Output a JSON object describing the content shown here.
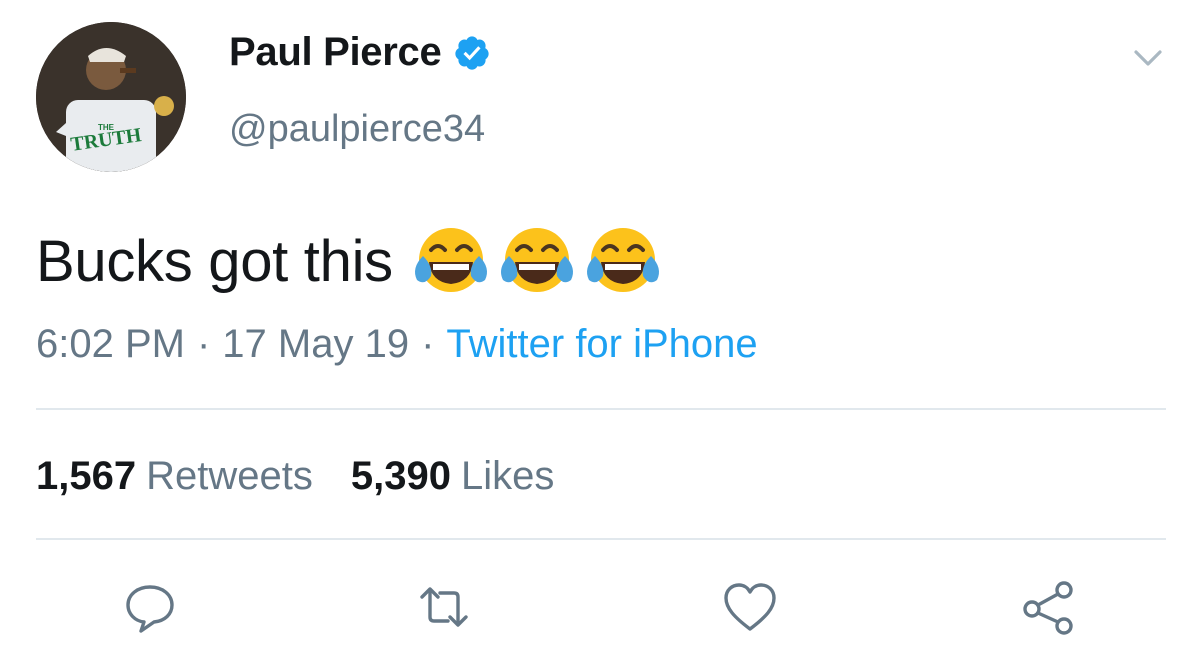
{
  "user": {
    "display_name": "Paul Pierce",
    "handle": "@paulpierce34",
    "verified": true,
    "avatar_shirt_text": "TRUTH",
    "avatar_shirt_small_text": "THE"
  },
  "tweet": {
    "text": "Bucks got this",
    "emoji_name": "face-with-tears-of-joy",
    "emoji_count": 3,
    "time": "6:02 PM",
    "date": "17 May 19",
    "source": "Twitter for iPhone",
    "separator": "·"
  },
  "stats": {
    "retweets_count": "1,567",
    "retweets_label": "Retweets",
    "likes_count": "5,390",
    "likes_label": "Likes"
  },
  "actions": {
    "reply_icon": "reply-icon",
    "retweet_icon": "retweet-icon",
    "like_icon": "heart-icon",
    "share_icon": "share-icon"
  },
  "colors": {
    "text": "#14171a",
    "secondary": "#657786",
    "link": "#1da1f2",
    "verified": "#1da1f2",
    "divider": "#e1e8ed",
    "icon": "#657786"
  }
}
